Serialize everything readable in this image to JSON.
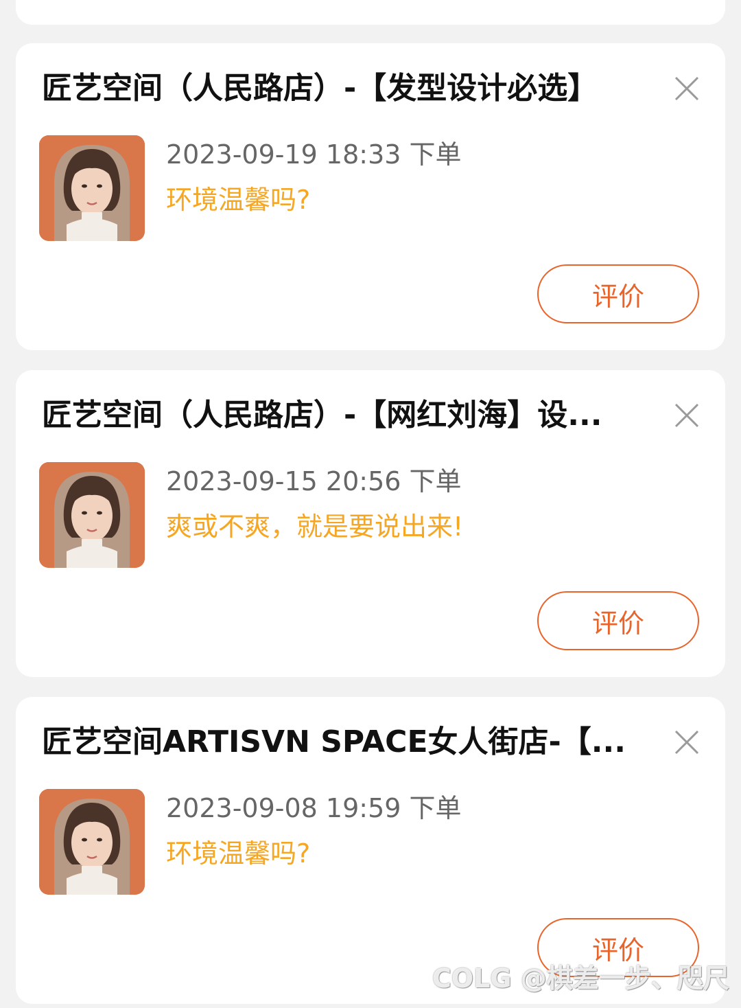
{
  "cards": [
    {
      "title": "匠艺空间（人民路店）-【发型设计必选】",
      "order_time": "2023-09-19 18:33 下单",
      "prompt": "环境温馨吗?",
      "review_label": "评价"
    },
    {
      "title": "匠艺空间（人民路店）-【网红刘海】设...",
      "order_time": "2023-09-15 20:56 下单",
      "prompt": "爽或不爽，就是要说出来!",
      "review_label": "评价"
    },
    {
      "title": "匠艺空间ARTISVN SPACE女人街店-【...",
      "order_time": "2023-09-08 19:59 下单",
      "prompt": "环境温馨吗?",
      "review_label": "评价"
    }
  ],
  "watermark": "COLG @棋差一步、咫尺",
  "colors": {
    "accent": "#e8642a",
    "prompt": "#f5a623",
    "background": "#f2f2f2"
  },
  "icons": {
    "close": "close-icon",
    "thumbnail": "portrait-thumbnail"
  }
}
